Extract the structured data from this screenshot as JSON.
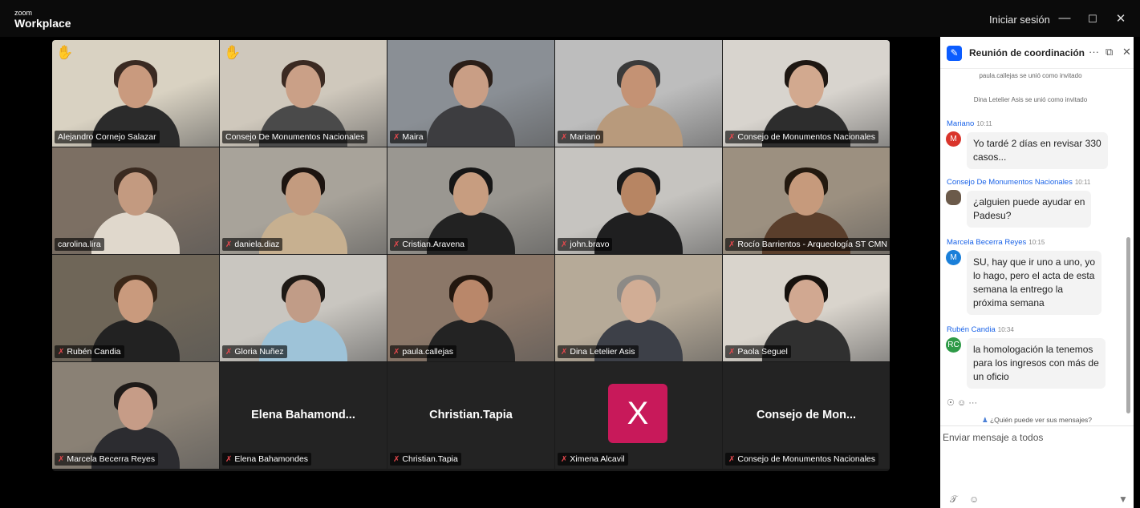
{
  "titlebar": {
    "brand_top": "zoom",
    "brand_bottom": "Workplace",
    "signin": "Iniciar sesión",
    "min_icon": "minimize-icon",
    "max_icon": "maximize-icon",
    "close_icon": "close-icon"
  },
  "tiles": [
    {
      "name": "Alejandro Cornejo Salazar",
      "muted": false,
      "hand": true,
      "hand_icon": "raised-hand-icon"
    },
    {
      "name": "Consejo De Monumentos Nacionales",
      "muted": false,
      "hand": true,
      "active": true,
      "hand_icon": "raised-hand-icon"
    },
    {
      "name": "Maira",
      "muted": true
    },
    {
      "name": "Mariano",
      "muted": true
    },
    {
      "name": "Consejo de Monumentos Nacionales",
      "muted": true
    },
    {
      "name": "carolina.lira",
      "muted": false
    },
    {
      "name": "daniela.diaz",
      "muted": true
    },
    {
      "name": "Cristian.Aravena",
      "muted": true
    },
    {
      "name": "john.bravo",
      "muted": true
    },
    {
      "name": "Rocío Barrientos - Arqueología ST CMN",
      "muted": true
    },
    {
      "name": "Rubén Candia",
      "muted": true
    },
    {
      "name": "Gloria Nuñez",
      "muted": true
    },
    {
      "name": "paula.callejas",
      "muted": true
    },
    {
      "name": "Dina Letelier Asis",
      "muted": true
    },
    {
      "name": "Paola Seguel",
      "muted": true
    },
    {
      "name": "Marcela Becerra Reyes",
      "muted": true
    },
    {
      "name": "Elena Bahamondes",
      "muted": true,
      "display": "Elena  Bahamond..."
    },
    {
      "name": "Christian.Tapia",
      "muted": true,
      "display": "Christian.Tapia"
    },
    {
      "name": "Ximena Alcavil",
      "muted": true,
      "avatar": "X"
    },
    {
      "name": "Consejo de Monumentos Nacionales",
      "muted": true,
      "display": "Consejo  de  Mon..."
    }
  ],
  "chat": {
    "title": "Reunión de coordinación N°...",
    "more_icon": "more-icon",
    "popout_icon": "popout-icon",
    "close_icon": "close-icon",
    "system": [
      "paula.callejas se unió como invitado",
      "Dina Letelier Asis se unió como invitado"
    ],
    "messages": [
      {
        "sender": "Mariano",
        "time": "10:11",
        "avatar": "M",
        "avatar_color": "#d9342b",
        "text": [
          "Yo tardé 2 días en revisar 330",
          "casos..."
        ]
      },
      {
        "sender": "Consejo De Monumentos Nacionales",
        "time": "10:11",
        "avatar": "",
        "avatar_color": "#6b5a4a",
        "text": [
          "¿alguien puede ayudar en",
          "Padesu?"
        ]
      },
      {
        "sender": "Marcela Becerra Reyes",
        "time": "10:15",
        "avatar": "M",
        "avatar_color": "#1a7fd9",
        "text": [
          "SU, hay que ir uno a uno, yo",
          "lo hago, pero el acta de esta",
          "semana la entrego la",
          "próxima semana"
        ]
      },
      {
        "sender": "Rubén Candia",
        "time": "10:34",
        "avatar": "RC",
        "avatar_color": "#2e9a47",
        "text": [
          "la homologación la tenemos",
          "para los ingresos con más de",
          "un oficio"
        ]
      }
    ],
    "actions": "⌕ ☺ ···",
    "who_can_see": "¿Quién puede ver sus mensajes?",
    "input_placeholder": "Enviar mensaje a todos",
    "format_icon": "format-icon",
    "emoji_icon": "emoji-icon",
    "send_icon": "send-icon"
  }
}
